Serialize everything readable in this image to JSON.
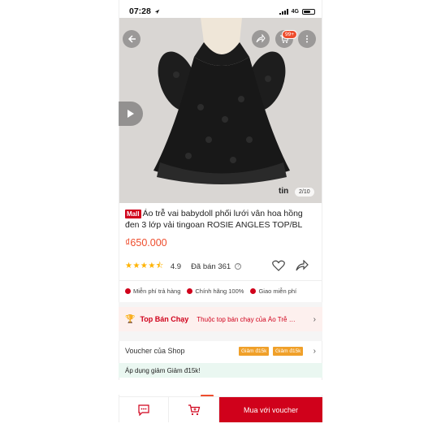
{
  "status_bar": {
    "time": "07:28",
    "network": "4G"
  },
  "product": {
    "mall_tag": "Mall",
    "title": "Áo trễ vai babydoll phối lưới vân hoa hồng đen 3 lớp vải tingoan ROSIE ANGLES TOP/BL",
    "price": "₫650.000",
    "brand_mark": "tin",
    "image_counter": "2/10"
  },
  "toolbar": {
    "cart_badge": "99+"
  },
  "rating": {
    "stars_value": 4.5,
    "stars_display": "★★★★⯪",
    "value": "4.9",
    "sold_label": "Đã bán 361"
  },
  "perks": [
    {
      "label": "Miễn phí trả hàng"
    },
    {
      "label": "Chính hãng 100%"
    },
    {
      "label": "Giao miễn phí"
    }
  ],
  "top_selling": {
    "title": "Top Bán Chạy",
    "description": "Thuộc top bán chạy của Áo Trễ Va..."
  },
  "voucher": {
    "label": "Voucher của Shop",
    "tags": [
      "Giảm đ15k",
      "Giảm đ15k"
    ],
    "note": "Áp dụng giảm Giảm đ15k!"
  },
  "bottom_bar": {
    "buy_label": "Mua với voucher"
  },
  "colors": {
    "accent": "#d0011b",
    "price": "#ee4d2d",
    "star": "#ffb300",
    "voucher_tag": "#f0a029"
  }
}
